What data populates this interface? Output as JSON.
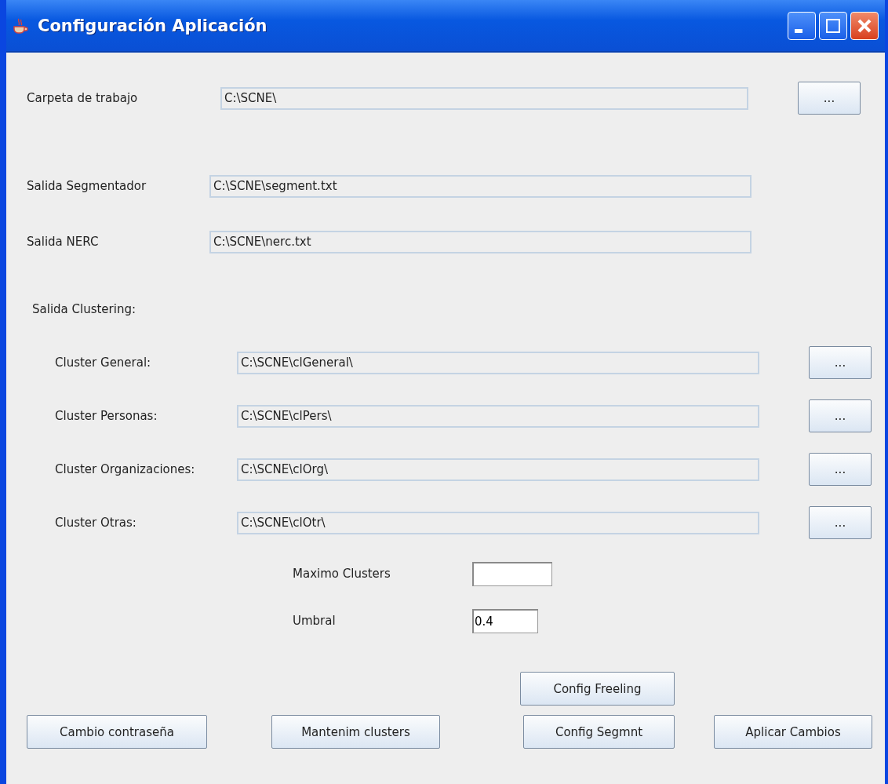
{
  "window": {
    "title": "Configuración Aplicación"
  },
  "paths": [
    {
      "label": "Carpeta de trabajo",
      "value": "C:\\SCNE\\",
      "button": "..."
    },
    {
      "label": "Salida Segmentador",
      "value": "C:\\SCNE\\segment.txt"
    },
    {
      "label": "Salida NERC",
      "value": "C:\\SCNE\\nerc.txt"
    }
  ],
  "clustering": {
    "heading": "Salida Clustering:",
    "paths": [
      {
        "label": "Cluster General:",
        "value": "C:\\SCNE\\clGeneral\\",
        "button": "..."
      },
      {
        "label": "Cluster Personas:",
        "value": "C:\\SCNE\\clPers\\",
        "button": "..."
      },
      {
        "label": "Cluster Organizaciones:",
        "value": "C:\\SCNE\\clOrg\\",
        "button": "..."
      },
      {
        "label": "Cluster Otras:",
        "value": "C:\\SCNE\\clOtr\\",
        "button": "..."
      }
    ]
  },
  "parameters": [
    {
      "label": "Maximo Clusters"
    },
    {
      "label": "Umbral",
      "value": "0.4"
    }
  ],
  "top_button": "Config Freeling",
  "buttons": [
    "Cambio contraseña",
    "Mantenim clusters",
    "Config Segmnt",
    "Aplicar Cambios"
  ]
}
